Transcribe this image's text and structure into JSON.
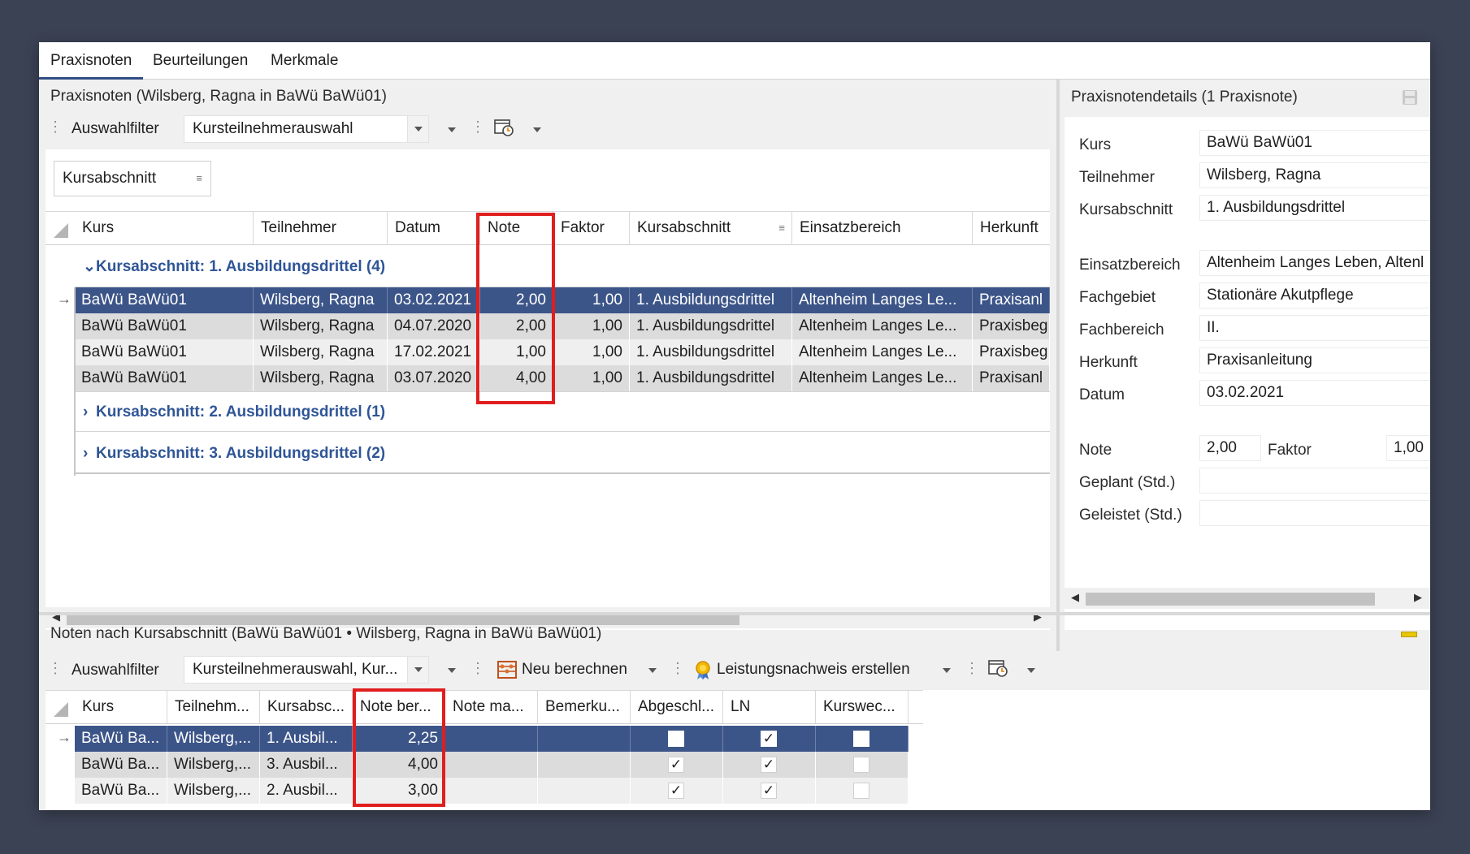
{
  "tabs": [
    "Praxisnoten",
    "Beurteilungen",
    "Merkmale"
  ],
  "top_panel": {
    "title": "Praxisnoten (Wilsberg, Ragna in BaWü BaWü01)",
    "filter_label": "Auswahlfilter",
    "filter_value": "Kursteilnehmerauswahl",
    "group_chip": "Kursabschnitt",
    "columns": [
      "Kurs",
      "Teilnehmer",
      "Datum",
      "Note",
      "Faktor",
      "Kursabschnitt",
      "Einsatzbereich",
      "Herkunft"
    ],
    "groups": [
      {
        "label": "Kursabschnitt: 1. Ausbildungsdrittel (4)",
        "expanded": true
      },
      {
        "label": "Kursabschnitt: 2. Ausbildungsdrittel (1)",
        "expanded": false
      },
      {
        "label": "Kursabschnitt: 3. Ausbildungsdrittel (2)",
        "expanded": false
      }
    ],
    "rows": [
      {
        "kurs": "BaWü BaWü01",
        "teilnehmer": "Wilsberg, Ragna",
        "datum": "03.02.2021",
        "note": "2,00",
        "faktor": "1,00",
        "kursabschnitt": "1. Ausbildungsdrittel",
        "einsatzbereich": "Altenheim Langes Le...",
        "herkunft": "Praxisanl"
      },
      {
        "kurs": "BaWü BaWü01",
        "teilnehmer": "Wilsberg, Ragna",
        "datum": "04.07.2020",
        "note": "2,00",
        "faktor": "1,00",
        "kursabschnitt": "1. Ausbildungsdrittel",
        "einsatzbereich": "Altenheim Langes Le...",
        "herkunft": "Praxisbeg"
      },
      {
        "kurs": "BaWü BaWü01",
        "teilnehmer": "Wilsberg, Ragna",
        "datum": "17.02.2021",
        "note": "1,00",
        "faktor": "1,00",
        "kursabschnitt": "1. Ausbildungsdrittel",
        "einsatzbereich": "Altenheim Langes Le...",
        "herkunft": "Praxisbeg"
      },
      {
        "kurs": "BaWü BaWü01",
        "teilnehmer": "Wilsberg, Ragna",
        "datum": "03.07.2020",
        "note": "4,00",
        "faktor": "1,00",
        "kursabschnitt": "1. Ausbildungsdrittel",
        "einsatzbereich": "Altenheim Langes Le...",
        "herkunft": "Praxisanl"
      }
    ]
  },
  "details": {
    "title": "Praxisnotendetails (1 Praxisnote)",
    "kurs_label": "Kurs",
    "kurs": "BaWü BaWü01",
    "teilnehmer_label": "Teilnehmer",
    "teilnehmer": "Wilsberg, Ragna",
    "kursabschnitt_label": "Kursabschnitt",
    "kursabschnitt": "1. Ausbildungsdrittel",
    "einsatzbereich_label": "Einsatzbereich",
    "einsatzbereich": "Altenheim Langes Leben, Altenl",
    "fachgebiet_label": "Fachgebiet",
    "fachgebiet": "Stationäre Akutpflege",
    "fachbereich_label": "Fachbereich",
    "fachbereich": "II.",
    "herkunft_label": "Herkunft",
    "herkunft": "Praxisanleitung",
    "datum_label": "Datum",
    "datum": "03.02.2021",
    "note_label": "Note",
    "note": "2,00",
    "faktor_label": "Faktor",
    "faktor": "1,00",
    "geplant_label": "Geplant (Std.)",
    "geplant": "",
    "geleistet_label": "Geleistet (Std.)",
    "geleistet": ""
  },
  "bottom_panel": {
    "title": "Noten nach Kursabschnitt (BaWü BaWü01 • Wilsberg, Ragna in BaWü BaWü01)",
    "filter_label": "Auswahlfilter",
    "filter_value": "Kursteilnehmerauswahl, Kur...",
    "neu_berechnen": "Neu berechnen",
    "leistungsnachweis": "Leistungsnachweis erstellen",
    "columns": [
      "Kurs",
      "Teilnehm...",
      "Kursabsc...",
      "Note ber...",
      "Note ma...",
      "Bemerku...",
      "Abgeschl...",
      "LN",
      "Kurswec..."
    ],
    "rows": [
      {
        "kurs": "BaWü Ba...",
        "teilnehmer": "Wilsberg,...",
        "kursabschnitt": "1. Ausbil...",
        "note_ber": "2,25",
        "note_ma": "",
        "bemerkung": "",
        "abgeschl": false,
        "ln": true,
        "kurswechsel": false
      },
      {
        "kurs": "BaWü Ba...",
        "teilnehmer": "Wilsberg,...",
        "kursabschnitt": "3. Ausbil...",
        "note_ber": "4,00",
        "note_ma": "",
        "bemerkung": "",
        "abgeschl": true,
        "ln": true,
        "kurswechsel": false
      },
      {
        "kurs": "BaWü Ba...",
        "teilnehmer": "Wilsberg,...",
        "kursabschnitt": "2. Ausbil...",
        "note_ber": "3,00",
        "note_ma": "",
        "bemerkung": "",
        "abgeschl": true,
        "ln": true,
        "kurswechsel": false
      }
    ]
  },
  "colors": {
    "selection": "#3c5589",
    "highlight": "#e01e1e",
    "group_text": "#2f5597"
  }
}
